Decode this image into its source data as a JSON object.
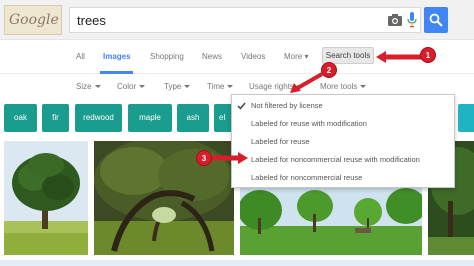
{
  "search": {
    "query": "trees"
  },
  "logo": {
    "text": "Google"
  },
  "tabs": [
    {
      "label": "All",
      "active": false
    },
    {
      "label": "Images",
      "active": true
    },
    {
      "label": "Shopping",
      "active": false
    },
    {
      "label": "News",
      "active": false
    },
    {
      "label": "Videos",
      "active": false
    },
    {
      "label": "More ▾",
      "active": false
    }
  ],
  "tools_button": {
    "label": "Search tools"
  },
  "filters": [
    {
      "label": "Size"
    },
    {
      "label": "Color"
    },
    {
      "label": "Type"
    },
    {
      "label": "Time"
    },
    {
      "label": "Usage rights"
    },
    {
      "label": "More tools"
    }
  ],
  "chips": [
    {
      "label": "oak",
      "color": "#1a9c8e"
    },
    {
      "label": "fir",
      "color": "#1a9c8e"
    },
    {
      "label": "redwood",
      "color": "#1a9c8e"
    },
    {
      "label": "maple",
      "color": "#1a9c8e"
    },
    {
      "label": "ash",
      "color": "#1a9c8e"
    },
    {
      "label": "el",
      "color": "#1a9c8e"
    }
  ],
  "usage_menu": {
    "items": [
      {
        "label": "Not filtered by license",
        "checked": true
      },
      {
        "label": "Labeled for reuse with modification",
        "checked": false
      },
      {
        "label": "Labeled for reuse",
        "checked": false
      },
      {
        "label": "Labeled for noncommercial reuse with modification",
        "checked": false
      },
      {
        "label": "Labeled for noncommercial reuse",
        "checked": false
      }
    ]
  },
  "callouts": [
    "1",
    "2",
    "3"
  ],
  "colors": {
    "accent": "#4285f4",
    "chip": "#1a9c8e",
    "callout": "#d81e2a"
  }
}
